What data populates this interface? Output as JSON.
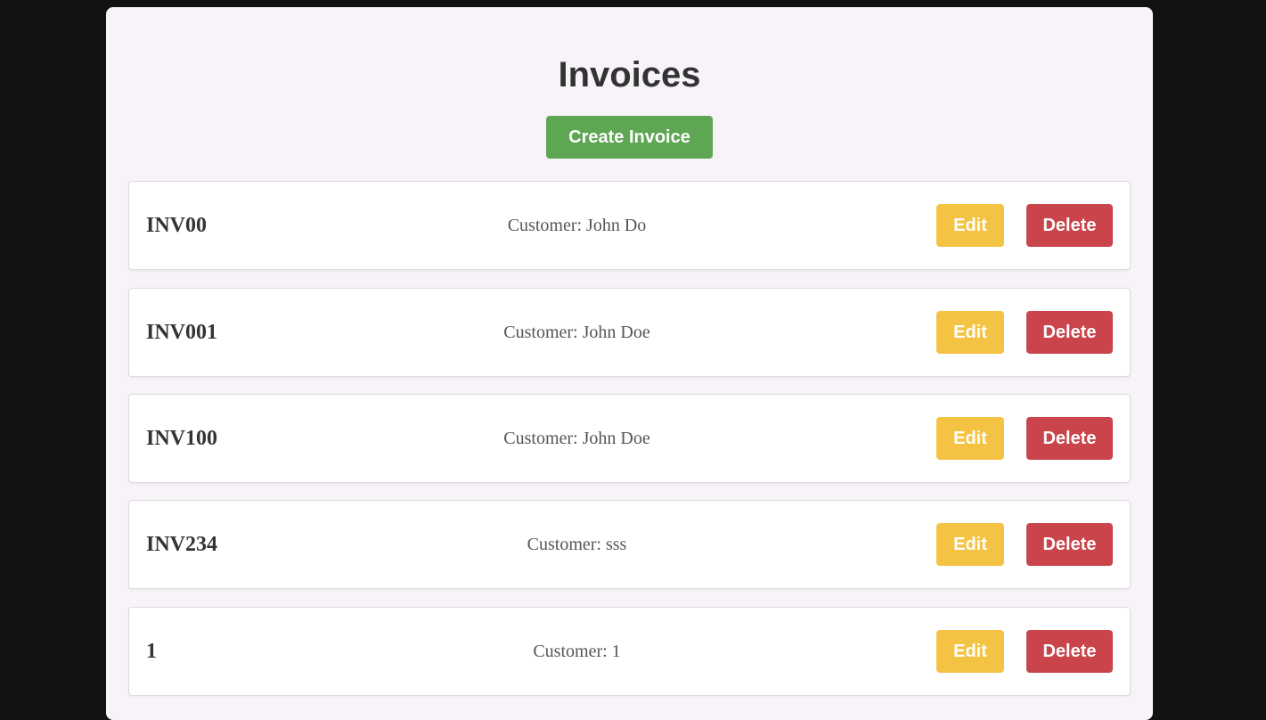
{
  "page": {
    "title": "Invoices",
    "create_button_label": "Create Invoice"
  },
  "invoices": [
    {
      "id": "INV00",
      "customer": "Customer: John Do"
    },
    {
      "id": "INV001",
      "customer": "Customer: John Doe"
    },
    {
      "id": "INV100",
      "customer": "Customer: John Doe"
    },
    {
      "id": "INV234",
      "customer": "Customer: sss"
    },
    {
      "id": "1",
      "customer": "Customer: 1"
    }
  ],
  "actions": {
    "edit_label": "Edit",
    "delete_label": "Delete"
  },
  "colors": {
    "background": "#121212",
    "panel": "#f7f3f8",
    "create": "#5ea653",
    "edit": "#f5c343",
    "delete": "#c9454b"
  }
}
